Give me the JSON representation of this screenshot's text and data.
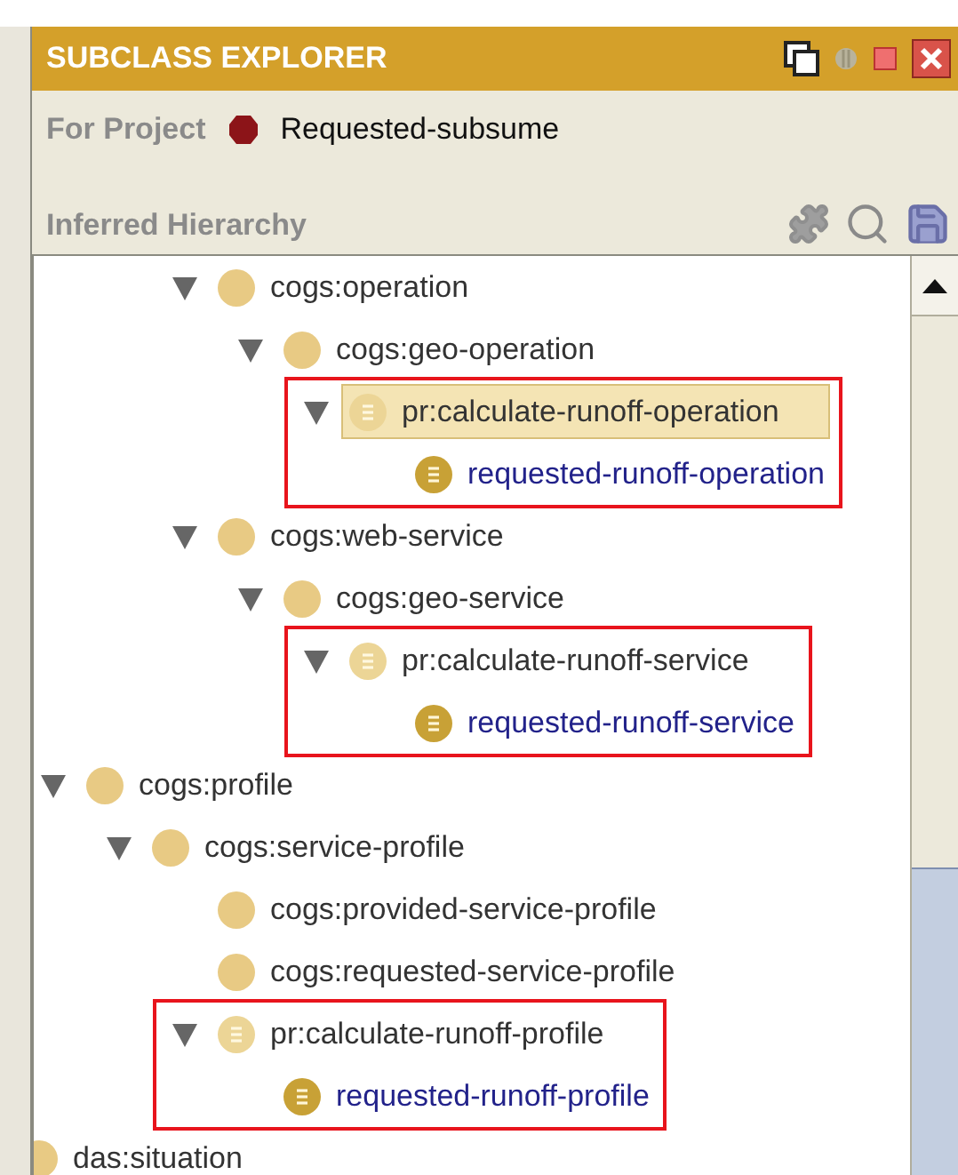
{
  "panel": {
    "title": "SUBCLASS EXPLORER",
    "project_label": "For Project",
    "project_name": "Requested-subsume",
    "section_title": "Inferred Hierarchy"
  },
  "tree": [
    {
      "children": [
        {
          "children": [
            {
              "children": [
                {
                  "label": "cogs:operation",
                  "kind": "class",
                  "expanded": true,
                  "selected": false,
                  "boxed": false,
                  "children": [
                    {
                      "label": "cogs:geo-operation",
                      "kind": "class",
                      "expanded": true,
                      "selected": false,
                      "boxed": false,
                      "children": [
                        {
                          "label": "pr:calculate-runoff-operation",
                          "kind": "defined",
                          "expanded": true,
                          "selected": true,
                          "boxed": true,
                          "children": [
                            {
                              "label": "requested-runoff-operation",
                              "kind": "instance",
                              "selected": false,
                              "boxed": false
                            }
                          ]
                        }
                      ]
                    }
                  ]
                },
                {
                  "label": "cogs:web-service",
                  "kind": "class",
                  "expanded": true,
                  "selected": false,
                  "boxed": false,
                  "children": [
                    {
                      "label": "cogs:geo-service",
                      "kind": "class",
                      "expanded": true,
                      "selected": false,
                      "boxed": false,
                      "children": [
                        {
                          "label": "pr:calculate-runoff-service",
                          "kind": "defined",
                          "expanded": true,
                          "selected": false,
                          "boxed": true,
                          "children": [
                            {
                              "label": "requested-runoff-service",
                              "kind": "instance",
                              "selected": false,
                              "boxed": false
                            }
                          ]
                        }
                      ]
                    }
                  ]
                }
              ]
            }
          ]
        },
        {
          "label": "cogs:profile",
          "kind": "class",
          "expanded": true,
          "selected": false,
          "boxed": false,
          "children": [
            {
              "label": "cogs:service-profile",
              "kind": "class",
              "expanded": true,
              "selected": false,
              "boxed": false,
              "children": [
                {
                  "label": "cogs:provided-service-profile",
                  "kind": "class",
                  "selected": false,
                  "boxed": false
                },
                {
                  "label": "cogs:requested-service-profile",
                  "kind": "class",
                  "selected": false,
                  "boxed": false
                },
                {
                  "label": "pr:calculate-runoff-profile",
                  "kind": "defined",
                  "expanded": true,
                  "selected": false,
                  "boxed": true,
                  "children": [
                    {
                      "label": "requested-runoff-profile",
                      "kind": "instance",
                      "selected": false,
                      "boxed": false
                    }
                  ]
                }
              ]
            }
          ]
        }
      ]
    },
    {
      "label": "das:situation",
      "kind": "class",
      "selected": false,
      "boxed": false
    }
  ]
}
